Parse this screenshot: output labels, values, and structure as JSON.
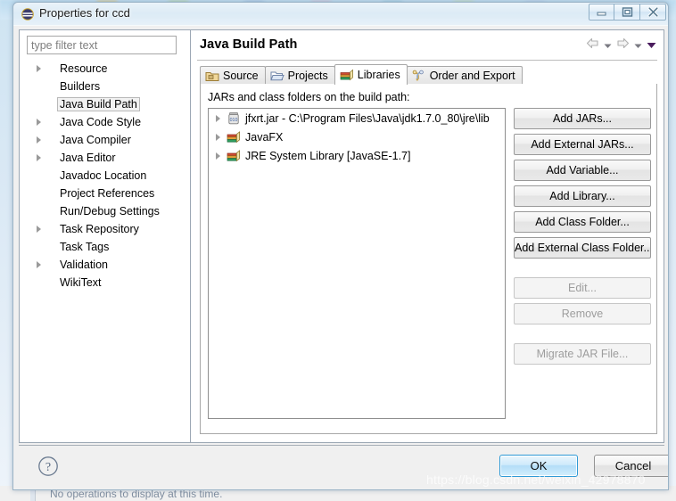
{
  "window": {
    "title": "Properties for ccd",
    "icon": "eclipse-icon",
    "controls": {
      "minimize": "minimize-icon",
      "maximize": "maximize-icon",
      "close": "close-icon"
    }
  },
  "sidebar": {
    "filter_placeholder": "type filter text",
    "filter_value": "",
    "items": [
      {
        "label": "Resource",
        "expandable": true,
        "selected": false
      },
      {
        "label": "Builders",
        "expandable": false,
        "selected": false
      },
      {
        "label": "Java Build Path",
        "expandable": false,
        "selected": true
      },
      {
        "label": "Java Code Style",
        "expandable": true,
        "selected": false
      },
      {
        "label": "Java Compiler",
        "expandable": true,
        "selected": false
      },
      {
        "label": "Java Editor",
        "expandable": true,
        "selected": false
      },
      {
        "label": "Javadoc Location",
        "expandable": false,
        "selected": false
      },
      {
        "label": "Project References",
        "expandable": false,
        "selected": false
      },
      {
        "label": "Run/Debug Settings",
        "expandable": false,
        "selected": false
      },
      {
        "label": "Task Repository",
        "expandable": true,
        "selected": false
      },
      {
        "label": "Task Tags",
        "expandable": false,
        "selected": false
      },
      {
        "label": "Validation",
        "expandable": true,
        "selected": false
      },
      {
        "label": "WikiText",
        "expandable": false,
        "selected": false
      }
    ]
  },
  "page": {
    "title": "Java Build Path",
    "nav": {
      "back": "back-arrow-icon",
      "back_menu": "chevron-down-icon",
      "forward": "forward-arrow-icon",
      "forward_menu": "chevron-down-icon",
      "view_menu": "view-menu-icon"
    },
    "tabs": [
      {
        "label": "Source",
        "icon": "source-folder-icon",
        "active": false
      },
      {
        "label": "Projects",
        "icon": "open-folder-icon",
        "active": false
      },
      {
        "label": "Libraries",
        "icon": "library-books-icon",
        "active": true
      },
      {
        "label": "Order and Export",
        "icon": "order-export-icon",
        "active": false
      }
    ],
    "libraries": {
      "caption": "JARs and class folders on the build path:",
      "entries": [
        {
          "label": "jfxrt.jar - C:\\Program Files\\Java\\jdk1.7.0_80\\jre\\lib",
          "icon": "jar-icon",
          "expandable": true
        },
        {
          "label": "JavaFX",
          "icon": "library-books-icon",
          "expandable": true
        },
        {
          "label": "JRE System Library [JavaSE-1.7]",
          "icon": "library-books-icon",
          "expandable": true
        }
      ],
      "buttons": [
        {
          "label": "Add JARs...",
          "enabled": true
        },
        {
          "label": "Add External JARs...",
          "enabled": true
        },
        {
          "label": "Add Variable...",
          "enabled": true
        },
        {
          "label": "Add Library...",
          "enabled": true
        },
        {
          "label": "Add Class Folder...",
          "enabled": true
        },
        {
          "label": "Add External Class Folder...",
          "enabled": true
        },
        {
          "label": "Edit...",
          "enabled": false
        },
        {
          "label": "Remove",
          "enabled": false
        },
        {
          "label": "Migrate JAR File...",
          "enabled": false
        }
      ]
    }
  },
  "footer": {
    "help": "help-icon",
    "ok_label": "OK",
    "cancel_label": "Cancel"
  },
  "overlay": {
    "watermark": "https://blog.csdn.net/weixin_42978870",
    "background_window_text": "No operations to display at this time."
  },
  "colors": {
    "accent_blue": "#2e9ad6",
    "title_text": "#1c1c1c",
    "disabled_text": "#9d9d9d",
    "book_green": "#2f9e5f",
    "book_orange": "#e8a33d",
    "book_red": "#cf4b32"
  }
}
